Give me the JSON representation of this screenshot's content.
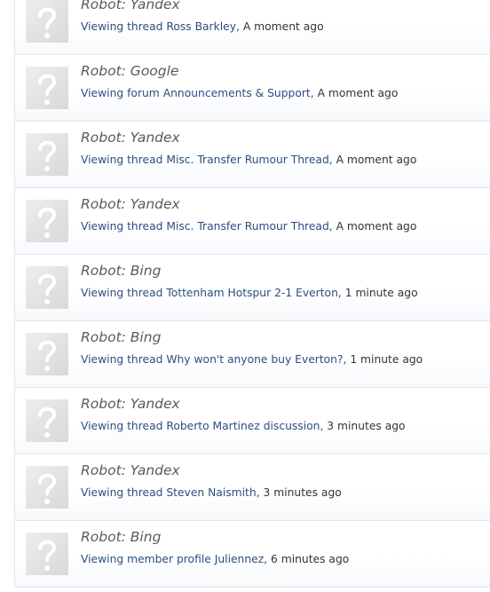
{
  "members": [
    {
      "name": "Robot: Yandex",
      "action": "Viewing thread",
      "target": "Ross Barkley",
      "time": "A moment ago"
    },
    {
      "name": "Robot: Google",
      "action": "Viewing forum",
      "target": "Announcements & Support",
      "time": "A moment ago"
    },
    {
      "name": "Robot: Yandex",
      "action": "Viewing thread",
      "target": "Misc. Transfer Rumour Thread",
      "time": "A moment ago"
    },
    {
      "name": "Robot: Yandex",
      "action": "Viewing thread",
      "target": "Misc. Transfer Rumour Thread",
      "time": "A moment ago"
    },
    {
      "name": "Robot: Bing",
      "action": "Viewing thread",
      "target": "Tottenham Hotspur 2-1 Everton",
      "time": "1 minute ago"
    },
    {
      "name": "Robot: Bing",
      "action": "Viewing thread",
      "target": "Why won't anyone buy Everton?",
      "time": "1 minute ago"
    },
    {
      "name": "Robot: Yandex",
      "action": "Viewing thread",
      "target": "Roberto Martinez discussion",
      "time": "3 minutes ago"
    },
    {
      "name": "Robot: Yandex",
      "action": "Viewing thread",
      "target": "Steven Naismith",
      "time": "3 minutes ago"
    },
    {
      "name": "Robot: Bing",
      "action": "Viewing member profile",
      "target": "Juliennez",
      "time": "6 minutes ago"
    }
  ],
  "avatar_icon": "question-mark-placeholder-icon",
  "colors": {
    "link": "#2b4e80",
    "name": "#5a5a5a",
    "divider": "#dfe7f1"
  }
}
